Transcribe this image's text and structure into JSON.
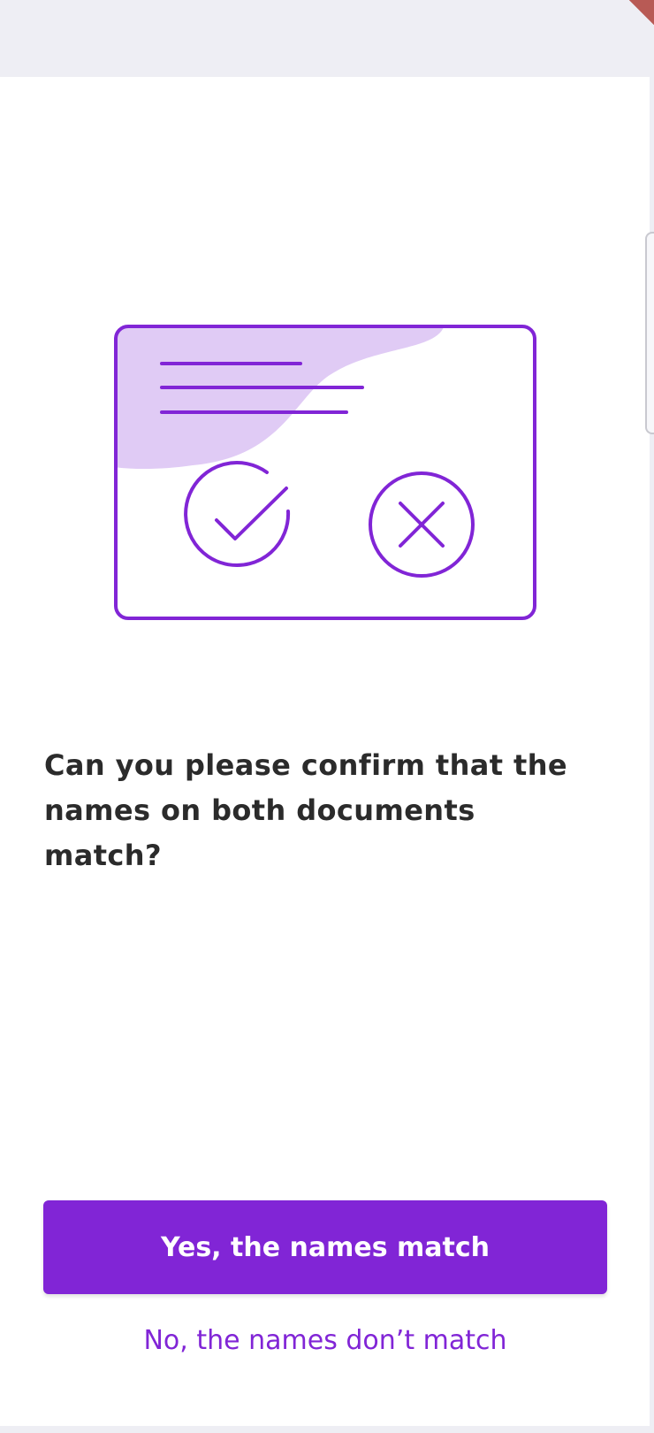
{
  "colors": {
    "accent": "#8125d6",
    "illustration_fill": "#e0cbf5",
    "text": "#2b2b2b",
    "background": "#ffffff",
    "chrome": "#eeeef4"
  },
  "illustration": {
    "icons": [
      "document-card-icon",
      "check-circle-icon",
      "x-circle-icon"
    ]
  },
  "question": {
    "text": "Can you please confirm that the names on both documents match?"
  },
  "actions": {
    "confirm_label": "Yes, the names match",
    "deny_label": "No, the names don’t match"
  }
}
